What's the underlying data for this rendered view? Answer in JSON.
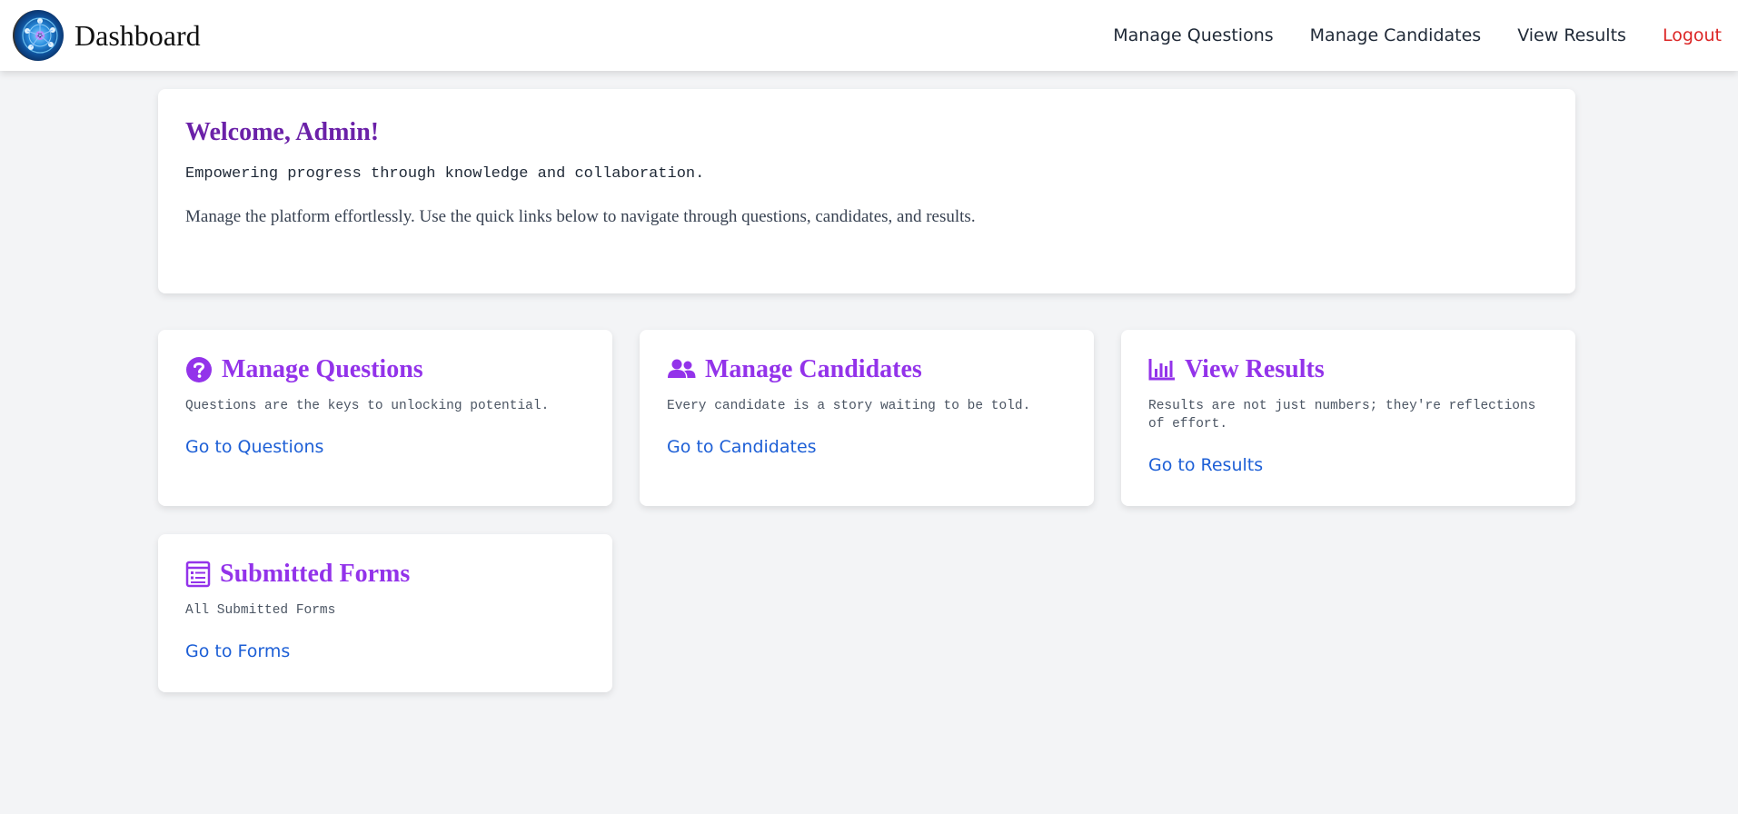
{
  "navbar": {
    "title": "Dashboard",
    "links": [
      "Manage Questions",
      "Manage Candidates",
      "View Results"
    ],
    "logout": "Logout"
  },
  "welcome": {
    "heading": "Welcome, Admin!",
    "tagline": "Empowering progress through knowledge and collaboration.",
    "description": "Manage the platform effortlessly. Use the quick links below to navigate through questions, candidates, and results."
  },
  "cards": [
    {
      "icon": "question-circle-icon",
      "title": "Manage Questions",
      "text": "Questions are the keys to unlocking potential.",
      "link": "Go to Questions"
    },
    {
      "icon": "users-icon",
      "title": "Manage Candidates",
      "text": "Every candidate is a story waiting to be told.",
      "link": "Go to Candidates"
    },
    {
      "icon": "bar-chart-icon",
      "title": "View Results",
      "text": "Results are not just numbers; they're reflections of effort.",
      "link": "Go to Results"
    },
    {
      "icon": "form-list-icon",
      "title": "Submitted Forms",
      "text": "All Submitted Forms",
      "link": "Go to Forms"
    }
  ],
  "colors": {
    "accent": "#9333ea",
    "heading": "#6b21a8",
    "link": "#1d5fd6",
    "logout": "#dc2626",
    "background": "#f3f4f6"
  }
}
